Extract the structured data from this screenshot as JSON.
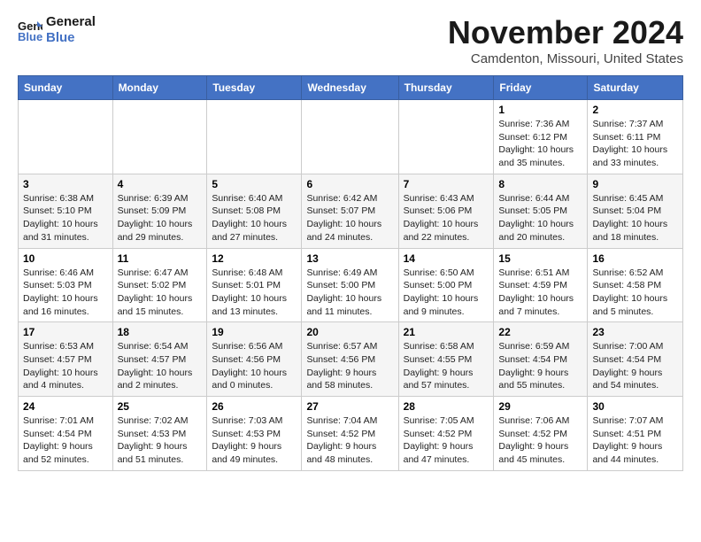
{
  "logo": {
    "line1": "General",
    "line2": "Blue"
  },
  "title": "November 2024",
  "location": "Camdenton, Missouri, United States",
  "headers": [
    "Sunday",
    "Monday",
    "Tuesday",
    "Wednesday",
    "Thursday",
    "Friday",
    "Saturday"
  ],
  "weeks": [
    [
      {
        "day": "",
        "info": ""
      },
      {
        "day": "",
        "info": ""
      },
      {
        "day": "",
        "info": ""
      },
      {
        "day": "",
        "info": ""
      },
      {
        "day": "",
        "info": ""
      },
      {
        "day": "1",
        "info": "Sunrise: 7:36 AM\nSunset: 6:12 PM\nDaylight: 10 hours and 35 minutes."
      },
      {
        "day": "2",
        "info": "Sunrise: 7:37 AM\nSunset: 6:11 PM\nDaylight: 10 hours and 33 minutes."
      }
    ],
    [
      {
        "day": "3",
        "info": "Sunrise: 6:38 AM\nSunset: 5:10 PM\nDaylight: 10 hours and 31 minutes."
      },
      {
        "day": "4",
        "info": "Sunrise: 6:39 AM\nSunset: 5:09 PM\nDaylight: 10 hours and 29 minutes."
      },
      {
        "day": "5",
        "info": "Sunrise: 6:40 AM\nSunset: 5:08 PM\nDaylight: 10 hours and 27 minutes."
      },
      {
        "day": "6",
        "info": "Sunrise: 6:42 AM\nSunset: 5:07 PM\nDaylight: 10 hours and 24 minutes."
      },
      {
        "day": "7",
        "info": "Sunrise: 6:43 AM\nSunset: 5:06 PM\nDaylight: 10 hours and 22 minutes."
      },
      {
        "day": "8",
        "info": "Sunrise: 6:44 AM\nSunset: 5:05 PM\nDaylight: 10 hours and 20 minutes."
      },
      {
        "day": "9",
        "info": "Sunrise: 6:45 AM\nSunset: 5:04 PM\nDaylight: 10 hours and 18 minutes."
      }
    ],
    [
      {
        "day": "10",
        "info": "Sunrise: 6:46 AM\nSunset: 5:03 PM\nDaylight: 10 hours and 16 minutes."
      },
      {
        "day": "11",
        "info": "Sunrise: 6:47 AM\nSunset: 5:02 PM\nDaylight: 10 hours and 15 minutes."
      },
      {
        "day": "12",
        "info": "Sunrise: 6:48 AM\nSunset: 5:01 PM\nDaylight: 10 hours and 13 minutes."
      },
      {
        "day": "13",
        "info": "Sunrise: 6:49 AM\nSunset: 5:00 PM\nDaylight: 10 hours and 11 minutes."
      },
      {
        "day": "14",
        "info": "Sunrise: 6:50 AM\nSunset: 5:00 PM\nDaylight: 10 hours and 9 minutes."
      },
      {
        "day": "15",
        "info": "Sunrise: 6:51 AM\nSunset: 4:59 PM\nDaylight: 10 hours and 7 minutes."
      },
      {
        "day": "16",
        "info": "Sunrise: 6:52 AM\nSunset: 4:58 PM\nDaylight: 10 hours and 5 minutes."
      }
    ],
    [
      {
        "day": "17",
        "info": "Sunrise: 6:53 AM\nSunset: 4:57 PM\nDaylight: 10 hours and 4 minutes."
      },
      {
        "day": "18",
        "info": "Sunrise: 6:54 AM\nSunset: 4:57 PM\nDaylight: 10 hours and 2 minutes."
      },
      {
        "day": "19",
        "info": "Sunrise: 6:56 AM\nSunset: 4:56 PM\nDaylight: 10 hours and 0 minutes."
      },
      {
        "day": "20",
        "info": "Sunrise: 6:57 AM\nSunset: 4:56 PM\nDaylight: 9 hours and 58 minutes."
      },
      {
        "day": "21",
        "info": "Sunrise: 6:58 AM\nSunset: 4:55 PM\nDaylight: 9 hours and 57 minutes."
      },
      {
        "day": "22",
        "info": "Sunrise: 6:59 AM\nSunset: 4:54 PM\nDaylight: 9 hours and 55 minutes."
      },
      {
        "day": "23",
        "info": "Sunrise: 7:00 AM\nSunset: 4:54 PM\nDaylight: 9 hours and 54 minutes."
      }
    ],
    [
      {
        "day": "24",
        "info": "Sunrise: 7:01 AM\nSunset: 4:54 PM\nDaylight: 9 hours and 52 minutes."
      },
      {
        "day": "25",
        "info": "Sunrise: 7:02 AM\nSunset: 4:53 PM\nDaylight: 9 hours and 51 minutes."
      },
      {
        "day": "26",
        "info": "Sunrise: 7:03 AM\nSunset: 4:53 PM\nDaylight: 9 hours and 49 minutes."
      },
      {
        "day": "27",
        "info": "Sunrise: 7:04 AM\nSunset: 4:52 PM\nDaylight: 9 hours and 48 minutes."
      },
      {
        "day": "28",
        "info": "Sunrise: 7:05 AM\nSunset: 4:52 PM\nDaylight: 9 hours and 47 minutes."
      },
      {
        "day": "29",
        "info": "Sunrise: 7:06 AM\nSunset: 4:52 PM\nDaylight: 9 hours and 45 minutes."
      },
      {
        "day": "30",
        "info": "Sunrise: 7:07 AM\nSunset: 4:51 PM\nDaylight: 9 hours and 44 minutes."
      }
    ]
  ]
}
